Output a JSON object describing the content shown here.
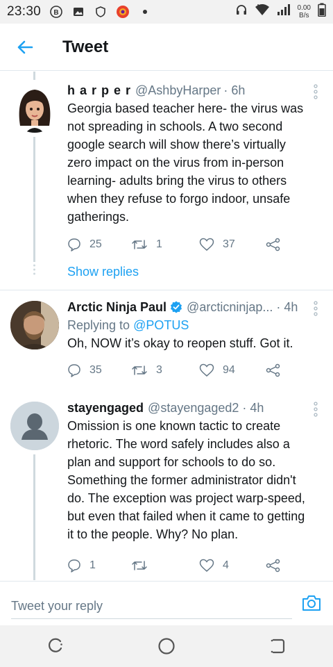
{
  "status_bar": {
    "time": "23:30",
    "net_speed_value": "0.00",
    "net_speed_unit": "B/s"
  },
  "header": {
    "title": "Tweet"
  },
  "tweets": [
    {
      "name": "h a r p e r",
      "handle": "@AshbyHarper",
      "time": "· 6h",
      "text": "Georgia based teacher here- the virus was not spreading in schools. A two second google search will show there’s virtually zero impact on the virus from in-person learning- adults bring the virus to others when they refuse to forgo indoor, unsafe gatherings.",
      "replies": "25",
      "retweets": "1",
      "likes": "37",
      "show_replies": "Show replies"
    },
    {
      "name": "Arctic Ninja Paul",
      "handle": "@arcticninjap...",
      "time": "· 4h",
      "replying_prefix": "Replying to ",
      "replying_to": "@POTUS",
      "text": "Oh, NOW it’s okay to reopen stuff. Got it.",
      "replies": "35",
      "retweets": "3",
      "likes": "94"
    },
    {
      "name": "stayengaged",
      "handle": "@stayengaged2",
      "time": "· 4h",
      "text": "Omission is one known tactic to create rhetoric. The word safely includes also a plan and support for schools to do so. Something the former administrator didn't do. The exception was project warp-speed, but even that failed when it came to getting it to the people. Why? No plan.",
      "replies": "1",
      "retweets": "",
      "likes": "4"
    }
  ],
  "reply_bar": {
    "placeholder": "Tweet your reply"
  },
  "colors": {
    "accent": "#1da1f2",
    "secondary_text": "#657786",
    "verified": "#1da1f2"
  }
}
